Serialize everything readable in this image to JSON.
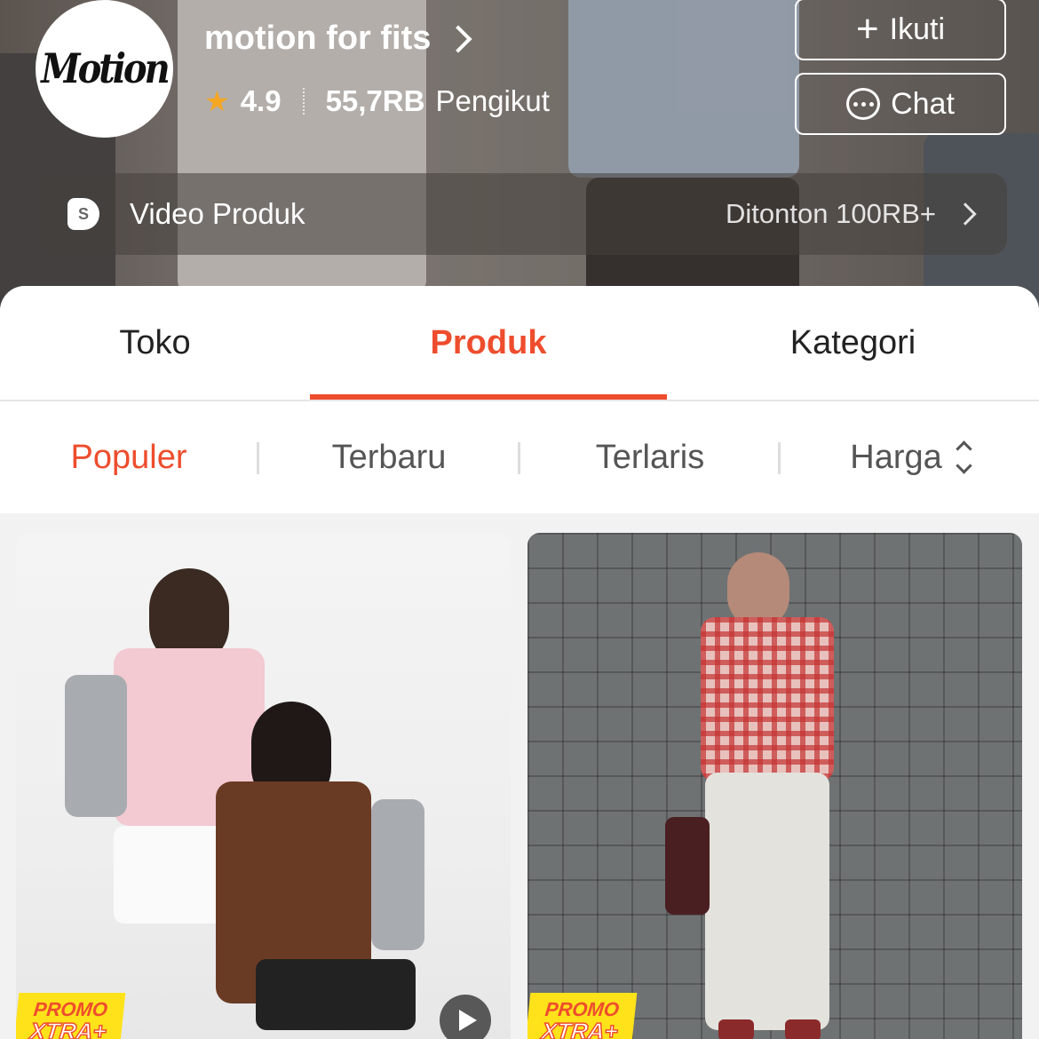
{
  "shop": {
    "avatar_text": "Motion",
    "name": "motion for fits",
    "rating": "4.9",
    "followers_count": "55,7RB",
    "followers_label": "Pengikut",
    "follow_label": "Ikuti",
    "chat_label": "Chat"
  },
  "video_bar": {
    "icon_letter": "S",
    "label": "Video Produk",
    "views": "Ditonton 100RB+"
  },
  "tabs": [
    {
      "label": "Toko",
      "active": false
    },
    {
      "label": "Produk",
      "active": true
    },
    {
      "label": "Kategori",
      "active": false
    }
  ],
  "sort": [
    {
      "label": "Populer",
      "active": true
    },
    {
      "label": "Terbaru",
      "active": false
    },
    {
      "label": "Terlaris",
      "active": false
    },
    {
      "label": "Harga",
      "active": false
    }
  ],
  "products": [
    {
      "promo_line1": "PROMO",
      "promo_line2": "XTRA+",
      "has_video": true
    },
    {
      "promo_line1": "PROMO",
      "promo_line2": "XTRA+",
      "has_video": false
    }
  ],
  "colors": {
    "accent": "#ee4d2d",
    "star": "#f5a623",
    "promo_bg": "#ffe21a"
  }
}
